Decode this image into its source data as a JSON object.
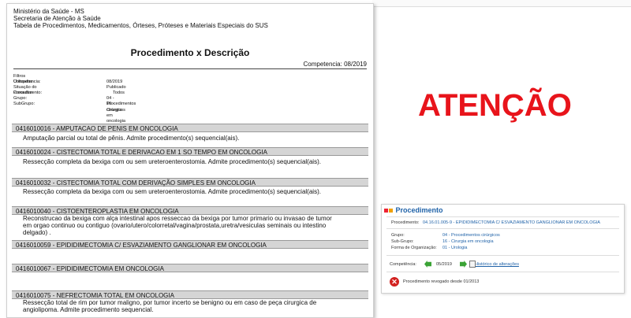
{
  "report": {
    "header_lines": [
      "Ministério da Saúde - MS",
      "Secretaria de Atenção à Saúde",
      "Tabela de Procedimentos, Medicamentos, Órteses, Próteses e Materiais Especiais do SUS"
    ],
    "title": "Procedimento x Descrição",
    "competencia_label": "Competencia:",
    "competencia_value": "08/2019",
    "filters_title": "Filtros Utilizados",
    "filters": [
      {
        "label": "Competencia:",
        "value": "08/2019"
      },
      {
        "label": "Situação do Procedimento:",
        "value": "Publicado"
      },
      {
        "label": "Consultar:",
        "value": "Todos"
      },
      {
        "label": "Grupo:",
        "value": "04 - Procedimentos cirúrgicos"
      },
      {
        "label": "SubGrupo:",
        "value": "16 - Cirurgia em oncologia"
      }
    ],
    "procedures": [
      {
        "code_name": "0416010016 - AMPUTACAO DE PENIS EM ONCOLOGIA",
        "desc": [
          "Amputação parcial ou total de pênis. Admite procedimento(s) sequencial(ais)."
        ]
      },
      {
        "code_name": "0416010024 - CISTECTOMIA TOTAL E DERIVACAO EM 1 SO TEMPO EM ONCOLOGIA",
        "desc": [
          "Ressecção completa da bexiga  com ou sem ureteroenterostomia. Admite procedimento(s) sequencial(ais)."
        ]
      },
      {
        "code_name": "0416010032 - CISTECTOMIA TOTAL COM DERIVAÇÃO SIMPLES EM ONCOLOGIA",
        "desc": [
          "Ressecção completa da bexiga  com ou sem ureteroenterostomia. Admite procedimento(s) sequencial(ais)."
        ]
      },
      {
        "code_name": "0416010040 - CISTOENTEROPLASTIA EM ONCOLOGIA",
        "desc": [
          "Reconstrucao da bexiga com alça intestinal apos resseccao da bexiga por tumor primario ou invasao de tumor",
          "em orgao continuo ou contiguo (ovario/utero/colorretal/vagina/prostata,uretra/vesiculas seminais ou intestino",
          "delgado) ."
        ]
      },
      {
        "code_name": "0416010059 - EPIDIDIMECTOMIA C/ ESVAZIAMENTO GANGLIONAR EM ONCOLOGIA",
        "desc": []
      },
      {
        "code_name": "0416010067 - EPIDIDIMECTOMIA EM ONCOLOGIA",
        "desc": []
      },
      {
        "code_name": "0416010075 - NEFRECTOMIA TOTAL EM ONCOLOGIA",
        "desc": [
          "Ressecção total de rim por tumor maligno, por tumor incerto se benigno ou em caso de peça cirurgica de",
          "angiolipoma.  Admite procedimento sequencial."
        ]
      }
    ]
  },
  "warning": "ATENÇÃO",
  "panel": {
    "title": "Procedimento",
    "procedimento_label": "Procedimento:",
    "procedimento_value": "04.16.01.005-9 - EPIDIDIMECTOMIA C/ ESVAZIAMENTO GANGLIONAR EM ONCOLOGIA",
    "grupo_label": "Grupo:",
    "grupo_value": "04 - Procedimentos cirúrgicos",
    "subgrupo_label": "Sub-Grupo:",
    "subgrupo_value": "16 - Cirurgia em oncologia",
    "forma_label": "Forma de Organização:",
    "forma_value": "01 - Urologia",
    "competencia_label": "Competência:",
    "competencia_value": "05/2019",
    "historico_link": "Histórico de alterações",
    "revoked_text": "Procedimento revogado desde 01/2013",
    "colors": {
      "title": "#1f62a8",
      "arrow": "#3aa335",
      "revoked": "#d2211f",
      "warning": "#e8141b"
    }
  }
}
